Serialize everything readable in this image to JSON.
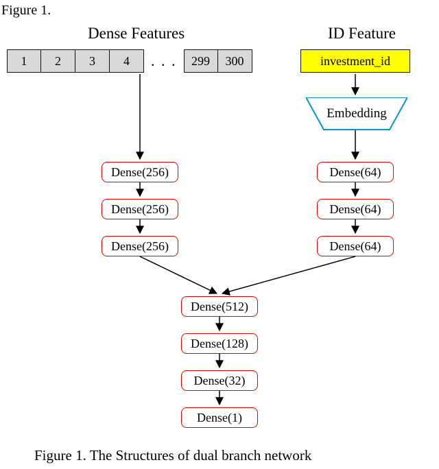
{
  "header": {
    "figure_ref": "Figure 1.",
    "dense_title": "Dense Features",
    "id_title": "ID Feature"
  },
  "dense_cells": {
    "first": [
      "1",
      "2",
      "3",
      "4"
    ],
    "ellipsis": ". . .",
    "last": [
      "299",
      "300"
    ]
  },
  "id_feature": {
    "label": "investment_id",
    "embedding": "Embedding"
  },
  "left_branch": [
    "Dense(256)",
    "Dense(256)",
    "Dense(256)"
  ],
  "right_branch": [
    "Dense(64)",
    "Dense(64)",
    "Dense(64)"
  ],
  "merged": [
    "Dense(512)",
    "Dense(128)",
    "Dense(32)",
    "Dense(1)"
  ],
  "caption": "Figure 1. The Structures of dual branch network",
  "chart_data": {
    "type": "diagram",
    "title": "Dual branch network",
    "inputs": {
      "dense_features": {
        "count": 300,
        "shown_indices": [
          1,
          2,
          3,
          4,
          299,
          300
        ]
      },
      "id_feature": "investment_id"
    },
    "branches": {
      "left": [
        {
          "op": "Dense",
          "units": 256
        },
        {
          "op": "Dense",
          "units": 256
        },
        {
          "op": "Dense",
          "units": 256
        }
      ],
      "right_pre": {
        "op": "Embedding"
      },
      "right": [
        {
          "op": "Dense",
          "units": 64
        },
        {
          "op": "Dense",
          "units": 64
        },
        {
          "op": "Dense",
          "units": 64
        }
      ]
    },
    "merge": "concat",
    "head": [
      {
        "op": "Dense",
        "units": 512
      },
      {
        "op": "Dense",
        "units": 128
      },
      {
        "op": "Dense",
        "units": 32
      },
      {
        "op": "Dense",
        "units": 1
      }
    ]
  }
}
